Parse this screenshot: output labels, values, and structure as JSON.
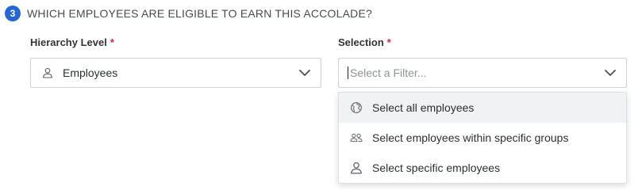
{
  "step": {
    "number": "3",
    "title": "WHICH EMPLOYEES ARE ELIGIBLE TO EARN THIS ACCOLADE?"
  },
  "hierarchy": {
    "label": "Hierarchy Level",
    "required_mark": "*",
    "value": "Employees",
    "icon": "person-icon"
  },
  "selection": {
    "label": "Selection",
    "required_mark": "*",
    "placeholder": "Select a Filter...",
    "options": [
      {
        "label": "Select all employees",
        "icon": "globe-icon",
        "highlighted": true
      },
      {
        "label": "Select employees within specific groups",
        "icon": "people-group-icon",
        "highlighted": false
      },
      {
        "label": "Select specific employees",
        "icon": "person-icon",
        "highlighted": false
      }
    ]
  },
  "colors": {
    "accent": "#2667d7",
    "required": "#d9233a",
    "highlight": "#f1f2f4"
  }
}
